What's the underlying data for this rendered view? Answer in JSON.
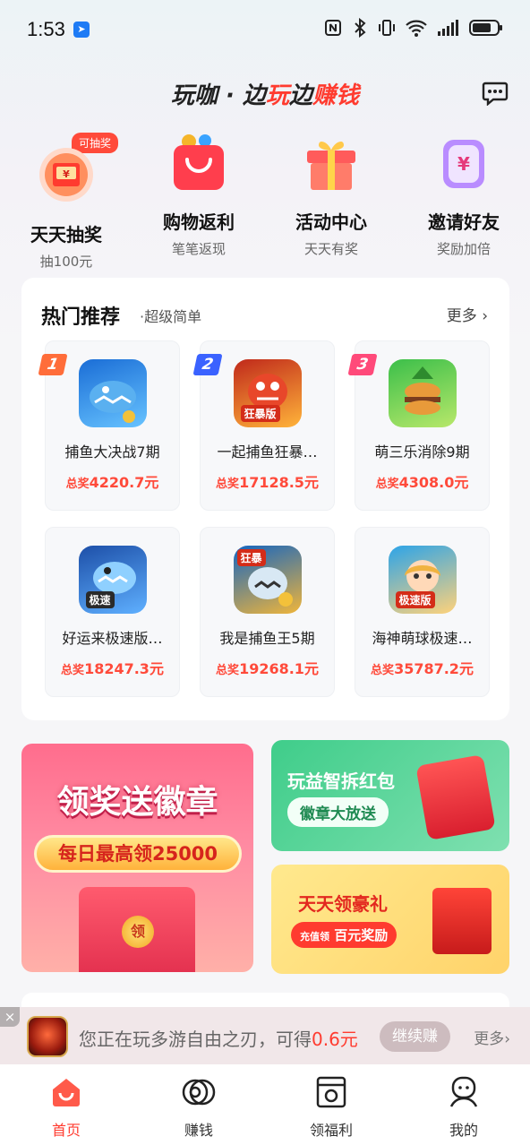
{
  "status_bar": {
    "time": "1:53"
  },
  "header": {
    "logo_part1": "玩咖 · 边",
    "logo_part2": "玩",
    "logo_part3": "边",
    "logo_part4": "赚钱"
  },
  "quick_entries": [
    {
      "title": "天天抽奖",
      "subtitle": "抽100元",
      "badge": "可抽奖",
      "icon": "lottery-icon"
    },
    {
      "title": "购物返利",
      "subtitle": "笔笔返现",
      "icon": "shopping-bag-icon"
    },
    {
      "title": "活动中心",
      "subtitle": "天天有奖",
      "icon": "gift-box-icon"
    },
    {
      "title": "邀请好友",
      "subtitle": "奖励加倍",
      "icon": "invite-icon"
    }
  ],
  "hot": {
    "title": "热门推荐",
    "subtitle": "·超级简单",
    "more": "更多",
    "prize_label": "总奖",
    "games": [
      {
        "rank": "1",
        "name": "捕鱼大决战7期",
        "prize": "4220.7元",
        "icon": "shark-game-icon",
        "colors": [
          "#1a6dd6",
          "#67c3ff"
        ]
      },
      {
        "rank": "2",
        "name": "一起捕鱼狂暴…",
        "prize": "17128.5元",
        "icon": "dragon-game-icon",
        "colors": [
          "#c0291b",
          "#ffb43a"
        ],
        "tag": "狂暴版"
      },
      {
        "rank": "3",
        "name": "萌三乐消除9期",
        "prize": "4308.0元",
        "icon": "burger-game-icon",
        "colors": [
          "#3bbf4a",
          "#b8e86a"
        ]
      },
      {
        "name": "好运来极速版…",
        "prize": "18247.3元",
        "icon": "shark-game-icon",
        "colors": [
          "#1d4fa8",
          "#5fb0ff"
        ],
        "tag": "极速"
      },
      {
        "name": "我是捕鱼王5期",
        "prize": "19268.1元",
        "icon": "shark-king-game-icon",
        "colors": [
          "#1565c0",
          "#f0b53a"
        ],
        "tag": "狂暴"
      },
      {
        "name": "海神萌球极速…",
        "prize": "35787.2元",
        "icon": "girl-game-icon",
        "colors": [
          "#2da4e8",
          "#ffd27a"
        ],
        "tag": "极速版"
      }
    ]
  },
  "banners": {
    "left": {
      "title": "领奖送徽章",
      "pill": "每日最高领25000",
      "coin": "领"
    },
    "right_top": {
      "title": "玩益智拆红包",
      "pill": "徽章大放送"
    },
    "right_bottom": {
      "title": "天天领豪礼",
      "pill_small": "充值领",
      "pill_big": "百元奖励"
    }
  },
  "playing_bar": {
    "close": "×",
    "text_prefix": "您正在玩多游自由之刃，可得",
    "amount": "0.6元",
    "button": "继续赚",
    "more": "更多"
  },
  "tabbar": [
    {
      "label": "首页",
      "icon": "home-icon",
      "active": true
    },
    {
      "label": "赚钱",
      "icon": "coin-stack-icon"
    },
    {
      "label": "领福利",
      "icon": "benefit-icon"
    },
    {
      "label": "我的",
      "icon": "profile-icon"
    }
  ],
  "colors": {
    "accent": "#ff3b2f",
    "prize": "#ff4a3a"
  }
}
